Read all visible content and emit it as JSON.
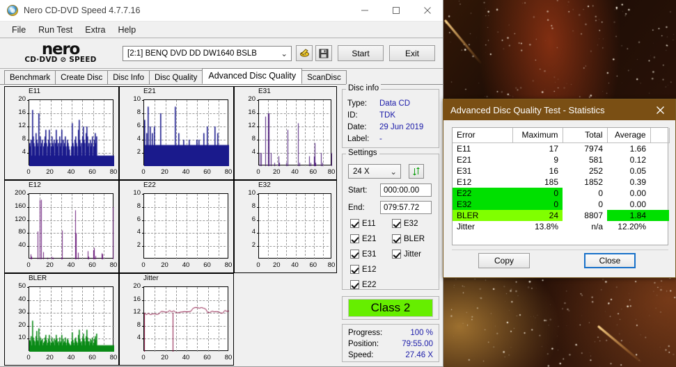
{
  "window": {
    "title": "Nero CD-DVD Speed 4.7.7.16",
    "icon": "nero-disc-icon",
    "minimize": "—",
    "maximize": "□",
    "close": "✕"
  },
  "menubar": {
    "items": [
      "File",
      "Run Test",
      "Extra",
      "Help"
    ]
  },
  "toolbar": {
    "logo_line1": "nero",
    "logo_line2": "CD·DVD ⊘ SPEED",
    "drive": "[2:1]   BENQ DVD DD DW1640 BSLB",
    "drive_chevron": "⌄",
    "eject_icon": "eject-disc-icon",
    "save_icon": "floppy-save-icon",
    "start_label": "Start",
    "exit_label": "Exit"
  },
  "tabs": {
    "items": [
      "Benchmark",
      "Create Disc",
      "Disc Info",
      "Disc Quality",
      "Advanced Disc Quality",
      "ScanDisc"
    ],
    "active": "Advanced Disc Quality"
  },
  "disc_info": {
    "legend": "Disc info",
    "rows": [
      {
        "key": "Type:",
        "value": "Data CD"
      },
      {
        "key": "ID:",
        "value": "TDK"
      },
      {
        "key": "Date:",
        "value": "29 Jun 2019"
      },
      {
        "key": "Label:",
        "value": "-"
      }
    ]
  },
  "settings": {
    "legend": "Settings",
    "speed": "24 X",
    "speed_chevron": "⌄",
    "refresh_icon": "refresh-arrows-icon",
    "start_label": "Start:",
    "start_value": "000:00.00",
    "end_label": "End:",
    "end_value": "079:57.72",
    "checkboxes_col1": [
      "E11",
      "E21",
      "E31",
      "E12",
      "E22"
    ],
    "checkboxes_col2": [
      "E32",
      "BLER",
      "Jitter"
    ]
  },
  "class_result": {
    "label": "Class 2",
    "color": "#66ee00"
  },
  "progress": {
    "rows": [
      {
        "key": "Progress:",
        "value": "100 %"
      },
      {
        "key": "Position:",
        "value": "79:55.00"
      },
      {
        "key": "Speed:",
        "value": "27.46 X"
      }
    ]
  },
  "dialog": {
    "title": "Advanced Disc Quality Test - Statistics",
    "close_icon": "close-icon",
    "headers": [
      "Error",
      "Maximum",
      "Total",
      "Average",
      ""
    ],
    "rows": [
      {
        "error": "E11",
        "maximum": "17",
        "total": "7974",
        "average": "1.66",
        "hl_error": "",
        "hl_max": "",
        "hl_avg": ""
      },
      {
        "error": "E21",
        "maximum": "9",
        "total": "581",
        "average": "0.12",
        "hl_error": "",
        "hl_max": "",
        "hl_avg": ""
      },
      {
        "error": "E31",
        "maximum": "16",
        "total": "252",
        "average": "0.05",
        "hl_error": "",
        "hl_max": "",
        "hl_avg": ""
      },
      {
        "error": "E12",
        "maximum": "185",
        "total": "1852",
        "average": "0.39",
        "hl_error": "",
        "hl_max": "",
        "hl_avg": ""
      },
      {
        "error": "E22",
        "maximum": "0",
        "total": "0",
        "average": "0.00",
        "hl_error": "#00e000",
        "hl_max": "#00e000",
        "hl_avg": ""
      },
      {
        "error": "E32",
        "maximum": "0",
        "total": "0",
        "average": "0.00",
        "hl_error": "#00e000",
        "hl_max": "#00e000",
        "hl_avg": ""
      },
      {
        "error": "BLER",
        "maximum": "24",
        "total": "8807",
        "average": "1.84",
        "hl_error": "#80ff00",
        "hl_max": "#80ff00",
        "hl_avg": "#00e000"
      },
      {
        "error": "Jitter",
        "maximum": "13.8%",
        "total": "n/a",
        "average": "12.20%",
        "hl_error": "",
        "hl_max": "",
        "hl_avg": ""
      }
    ],
    "copy_label": "Copy",
    "close_label": "Close"
  },
  "chart_data": [
    {
      "type": "bar",
      "title": "E11",
      "color": "#1a1a8c",
      "xlabel": "",
      "ylabel": "",
      "xlim": [
        0,
        80
      ],
      "ylim": [
        0,
        20
      ],
      "grid": true,
      "xticks": [
        0,
        20,
        40,
        60,
        80
      ],
      "yticks": [
        4,
        8,
        12,
        16,
        20
      ],
      "x": [
        0,
        0.8,
        1.6,
        2.4,
        3.2,
        4,
        4.8,
        5.6,
        6.4,
        7.2,
        8,
        8.8,
        9.6,
        10.4,
        11.2,
        12,
        12.8,
        13.6,
        14.4,
        15.2,
        16,
        16.8,
        17.6,
        18.4,
        19.2,
        20,
        20.8,
        21.6,
        22.4,
        23.2,
        24,
        24.8,
        25.6,
        26.4,
        27.2,
        28,
        28.8,
        29.6,
        30.4,
        31.2,
        32,
        32.8,
        33.6,
        34.4,
        35.2,
        36,
        36.8,
        37.6,
        38.4,
        39.2,
        40,
        40.8,
        41.6,
        42.4,
        43.2,
        44,
        44.8,
        45.6,
        46.4,
        47.2,
        48,
        48.8,
        49.6,
        50.4,
        51.2,
        52,
        52.8,
        53.6,
        54.4,
        55.2,
        56,
        56.8,
        57.6,
        58.4,
        59.2,
        60,
        60.8,
        61.6,
        62.4,
        63.2,
        64,
        64.8,
        65.6,
        66.4,
        67.2,
        68,
        68.8,
        69.6,
        70.4,
        71.2,
        72,
        72.8,
        73.6,
        74.4,
        75.2,
        76,
        76.8,
        77.6,
        78.4,
        79.2
      ],
      "values": [
        7,
        6,
        8,
        17,
        9,
        7,
        6,
        10,
        8,
        7,
        6,
        16,
        9,
        6,
        7,
        8,
        6,
        7,
        9,
        11,
        7,
        6,
        8,
        11,
        7,
        6,
        9,
        7,
        6,
        8,
        7,
        11,
        8,
        6,
        7,
        9,
        6,
        7,
        11,
        8,
        6,
        7,
        9,
        6,
        8,
        7,
        6,
        5,
        3,
        6,
        13,
        7,
        6,
        8,
        9,
        7,
        6,
        11,
        14,
        8,
        6,
        7,
        9,
        12,
        8,
        7,
        10,
        12,
        9,
        6,
        7,
        8,
        6,
        7,
        9,
        6,
        8,
        10,
        7,
        9
      ]
    },
    {
      "type": "bar",
      "title": "E21",
      "color": "#1a1a8c",
      "xlabel": "",
      "ylabel": "",
      "xlim": [
        0,
        80
      ],
      "ylim": [
        0,
        10
      ],
      "grid": true,
      "xticks": [
        0,
        20,
        40,
        60,
        80
      ],
      "yticks": [
        2,
        4,
        6,
        8,
        10
      ],
      "x": [
        0,
        1,
        2,
        3,
        4,
        5,
        6,
        7,
        8,
        9,
        10,
        11,
        12,
        13,
        14,
        15,
        16,
        17,
        18,
        19,
        20,
        21,
        22,
        23,
        24,
        25,
        26,
        27,
        28,
        29,
        30,
        31,
        32,
        33,
        34,
        35,
        36,
        37,
        38,
        39,
        40,
        41,
        42,
        43,
        44,
        45,
        46,
        47,
        48,
        49,
        50,
        51,
        52,
        53,
        54,
        55,
        56,
        57,
        58,
        59,
        60,
        61,
        62,
        63,
        64,
        65,
        66,
        67,
        68,
        69,
        70,
        71,
        72,
        73,
        74,
        75,
        76,
        77,
        78,
        79
      ],
      "values": [
        7,
        2,
        5,
        9,
        2,
        6,
        1,
        5,
        2,
        6,
        1,
        3,
        2,
        1,
        1,
        8,
        3,
        2,
        1,
        2,
        1,
        0,
        0,
        0,
        0,
        0,
        0,
        1,
        3,
        9,
        3,
        2,
        5,
        1,
        1,
        2,
        1,
        4,
        1,
        1,
        2,
        3,
        4,
        2,
        1,
        1,
        2,
        1,
        3,
        4,
        1,
        4,
        3,
        1,
        1,
        2,
        5,
        2,
        1,
        6,
        1,
        2,
        1,
        1,
        2,
        1,
        6,
        1,
        1,
        5,
        1,
        1,
        2,
        1,
        1,
        1,
        1,
        1,
        1,
        1
      ]
    },
    {
      "type": "bar",
      "title": "E31",
      "color": "#4b1a7a",
      "xlabel": "",
      "ylabel": "",
      "xlim": [
        0,
        80
      ],
      "ylim": [
        0,
        20
      ],
      "grid": true,
      "xticks": [
        0,
        20,
        40,
        60,
        80
      ],
      "yticks": [
        4,
        8,
        12,
        16,
        20
      ],
      "x": [
        1,
        2,
        7,
        10,
        11,
        13,
        17,
        21,
        22,
        30,
        31,
        43,
        44,
        55,
        56,
        60,
        61,
        62,
        68,
        69,
        79
      ],
      "values": [
        4,
        4,
        15,
        16,
        16,
        4,
        1,
        3,
        1,
        1,
        11,
        13,
        1,
        3,
        1,
        3,
        7,
        1,
        4,
        1,
        4
      ]
    },
    {
      "type": "bar",
      "title": "E12",
      "color": "#6a1a7a",
      "xlabel": "",
      "ylabel": "",
      "xlim": [
        0,
        80
      ],
      "ylim": [
        0,
        200
      ],
      "grid": true,
      "xticks": [
        0,
        20,
        40,
        60,
        80
      ],
      "yticks": [
        40,
        80,
        120,
        160,
        200
      ],
      "x": [
        1,
        2,
        8,
        10,
        11,
        13,
        17,
        21,
        22,
        30,
        31,
        43,
        44,
        46,
        55,
        56,
        60,
        61,
        62,
        68,
        69,
        79
      ],
      "values": [
        15,
        8,
        85,
        182,
        182,
        22,
        5,
        8,
        5,
        5,
        88,
        150,
        80,
        20,
        25,
        8,
        28,
        35,
        10,
        18,
        16,
        160
      ]
    },
    {
      "type": "bar",
      "title": "E22",
      "color": "#1a1a8c",
      "xlabel": "",
      "ylabel": "",
      "xlim": [
        0,
        80
      ],
      "ylim": [
        0,
        10
      ],
      "grid": true,
      "xticks": [
        0,
        20,
        40,
        60,
        80
      ],
      "yticks": [
        2,
        4,
        6,
        8,
        10
      ],
      "x": [],
      "values": []
    },
    {
      "type": "bar",
      "title": "E32",
      "color": "#1a1a8c",
      "xlabel": "",
      "ylabel": "",
      "xlim": [
        0,
        80
      ],
      "ylim": [
        0,
        10
      ],
      "grid": true,
      "xticks": [
        0,
        20,
        40,
        60,
        80
      ],
      "yticks": [
        2,
        4,
        6,
        8,
        10
      ],
      "x": [],
      "values": []
    },
    {
      "type": "bar",
      "title": "BLER",
      "color": "#0a8a16",
      "xlabel": "",
      "ylabel": "",
      "xlim": [
        0,
        80
      ],
      "ylim": [
        0,
        50
      ],
      "grid": true,
      "xticks": [
        0,
        20,
        40,
        60,
        80
      ],
      "yticks": [
        10,
        20,
        30,
        40,
        50
      ],
      "x": [
        0,
        0.8,
        1.6,
        2.4,
        3.2,
        4,
        4.8,
        5.6,
        6.4,
        7.2,
        8,
        8.8,
        9.6,
        10.4,
        11.2,
        12,
        12.8,
        13.6,
        14.4,
        15.2,
        16,
        16.8,
        17.6,
        18.4,
        19.2,
        20,
        20.8,
        21.6,
        22.4,
        23.2,
        24,
        24.8,
        25.6,
        26.4,
        27.2,
        28,
        28.8,
        29.6,
        30.4,
        31.2,
        32,
        32.8,
        33.6,
        34.4,
        35.2,
        36,
        36.8,
        37.6,
        38.4,
        39.2,
        40,
        40.8,
        41.6,
        42.4,
        43.2,
        44,
        44.8,
        45.6,
        46.4,
        47.2,
        48,
        48.8,
        49.6,
        50.4,
        51.2,
        52,
        52.8,
        53.6,
        54.4,
        55.2,
        56,
        56.8,
        57.6,
        58.4,
        59.2,
        60,
        60.8,
        61.6,
        62.4,
        63.2,
        64,
        64.8,
        65.6,
        66.4,
        67.2,
        68,
        68.8,
        69.6,
        70.4,
        71.2,
        72,
        72.8,
        73.6,
        74.4,
        75.2,
        76,
        76.8,
        77.6,
        78.4,
        79.2
      ],
      "values": [
        9,
        8,
        12,
        24,
        11,
        9,
        8,
        12,
        16,
        9,
        8,
        18,
        11,
        8,
        9,
        10,
        7,
        8,
        11,
        13,
        9,
        7,
        10,
        13,
        8,
        7,
        11,
        8,
        7,
        10,
        9,
        13,
        10,
        7,
        8,
        11,
        7,
        8,
        13,
        10,
        7,
        8,
        11,
        7,
        10,
        9,
        7,
        6,
        5,
        8,
        15,
        9,
        7,
        10,
        11,
        8,
        7,
        13,
        17,
        10,
        7,
        8,
        11,
        14,
        10,
        8,
        12,
        17,
        11,
        8,
        8,
        10,
        7,
        9,
        11,
        7,
        10,
        12,
        9,
        14
      ]
    },
    {
      "type": "line",
      "title": "Jitter",
      "color": "#8a1040",
      "xlabel": "",
      "ylabel": "",
      "xlim": [
        0,
        80
      ],
      "ylim": [
        0,
        20
      ],
      "grid": true,
      "xticks": [
        0,
        20,
        40,
        60,
        80
      ],
      "yticks": [
        4,
        8,
        12,
        16,
        20
      ],
      "x": [
        0,
        2,
        4,
        6,
        8,
        10,
        12,
        14,
        16,
        18,
        20,
        22,
        24,
        26,
        28,
        30,
        32,
        34,
        36,
        38,
        40,
        42,
        44,
        46,
        48,
        50,
        52,
        54,
        56,
        58,
        60,
        62,
        64,
        66,
        68,
        70,
        72,
        74,
        76,
        78,
        80
      ],
      "values": [
        11.8,
        11.7,
        11.6,
        11.5,
        11.6,
        11.7,
        11.6,
        11.5,
        11.7,
        11.8,
        11.9,
        11.8,
        11.9,
        12.0,
        12.2,
        12.1,
        12.3,
        12.2,
        12.4,
        12.3,
        12.5,
        12.4,
        12.6,
        12.7,
        12.8,
        12.9,
        12.8,
        12.7,
        12.6,
        12.5,
        12.4,
        12.3,
        12.4,
        12.3,
        12.2,
        12.4,
        12.3,
        12.2,
        12.1,
        12.0,
        12.0
      ]
    }
  ]
}
